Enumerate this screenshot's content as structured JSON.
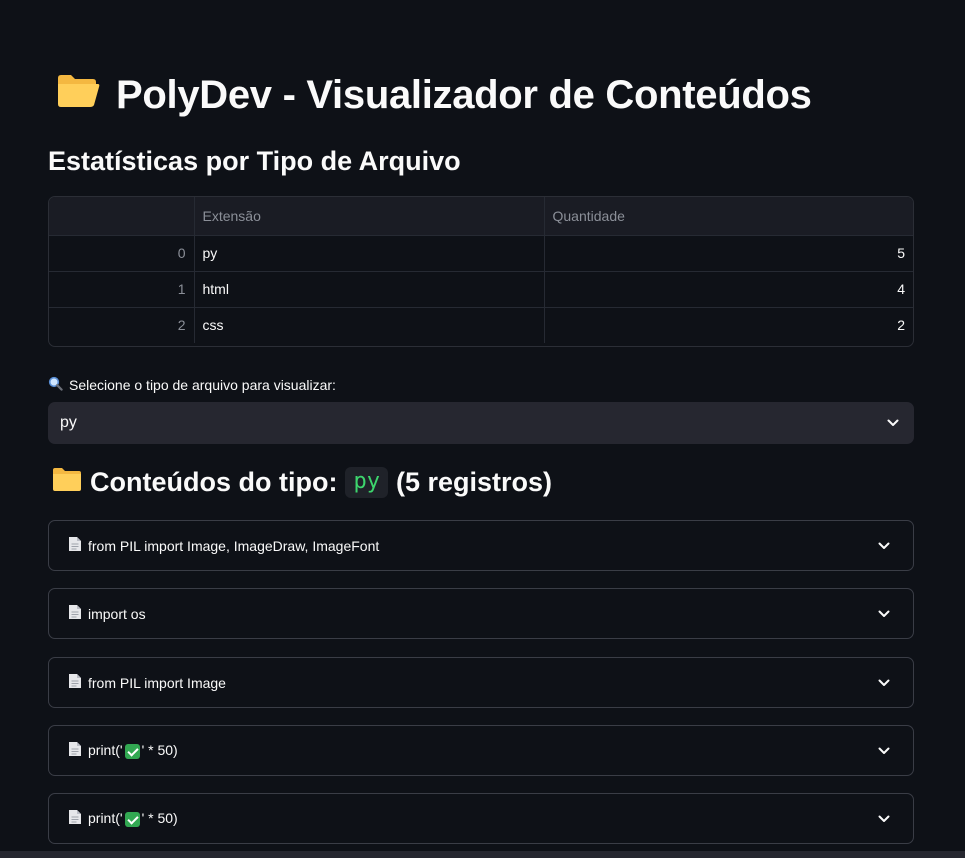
{
  "app": {
    "title": "PolyDev - Visualizador de Conteúdos",
    "title_icon": "open-folder-icon"
  },
  "stats": {
    "heading": "Estatísticas por Tipo de Arquivo",
    "columns": [
      "",
      "Extensão",
      "Quantidade"
    ],
    "rows": [
      {
        "index": "0",
        "ext": "py",
        "qty": "5"
      },
      {
        "index": "1",
        "ext": "html",
        "qty": "4"
      },
      {
        "index": "2",
        "ext": "css",
        "qty": "2"
      }
    ]
  },
  "select": {
    "label": "Selecione o tipo de arquivo para visualizar:",
    "label_icon": "magnifier-icon",
    "value": "py"
  },
  "contents": {
    "heading_prefix": "Conteúdos do tipo:",
    "ext": "py",
    "count_text": "(5 registros)",
    "heading_icon": "folder-icon",
    "items": [
      {
        "text": "from PIL import Image, ImageDraw, ImageFont",
        "has_check": false
      },
      {
        "text": "import os",
        "has_check": false
      },
      {
        "text": "from PIL import Image",
        "has_check": false
      },
      {
        "text_before": "print('",
        "text_after": "' * 50)",
        "has_check": true
      },
      {
        "text_before": "print('",
        "text_after": "' * 50)",
        "has_check": true
      }
    ]
  },
  "colors": {
    "background": "#0e1117",
    "select_bg": "#262730",
    "code_green": "#3dd56d",
    "check_green": "#32a852"
  }
}
